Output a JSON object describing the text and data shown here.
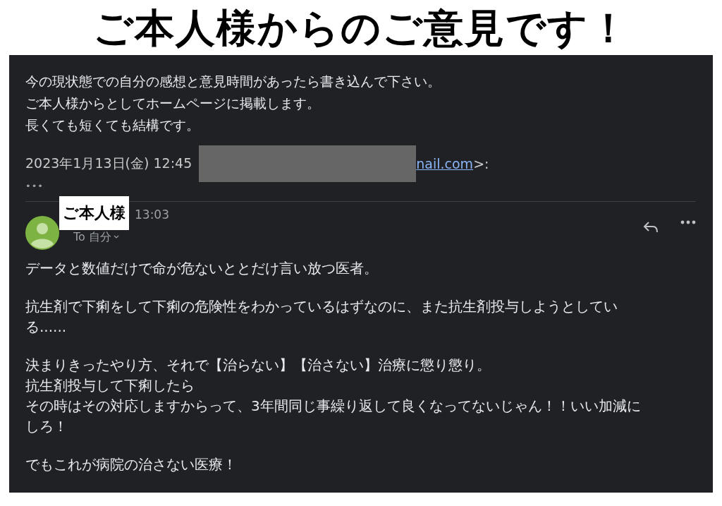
{
  "heading": "ご本人様からのご意見です！",
  "quoted": {
    "lines": [
      "今の現状態での自分の感想と意見時間があったら書き込んで下さい。",
      "ご本人様からとしてホームページに掲載します。",
      "長くても短くても結構です。"
    ],
    "date": "2023年1月13日(金) 12:45",
    "email_fragment": "nail.com",
    "suffix": ">:",
    "more": "•••"
  },
  "message": {
    "sender": "ご本人様",
    "time": "13:03",
    "recipient": "To 自分",
    "paragraphs": [
      [
        "データと数値だけで命が危ないととだけ言い放つ医者。"
      ],
      [
        "抗生剤で下痢をして下痢の危険性をわかっているはずなのに、また抗生剤投与しようとしてい",
        "る......"
      ],
      [
        "決まりきったやり方、それで【治らない】【治さない】治療に懲り懲り。",
        "抗生剤投与して下痢したら",
        "その時はその対応しますからって、3年間同じ事繰り返して良くなってないじゃん！！いい加減に",
        "しろ！"
      ],
      [
        "でもこれが病院の治さない医療！"
      ]
    ]
  }
}
